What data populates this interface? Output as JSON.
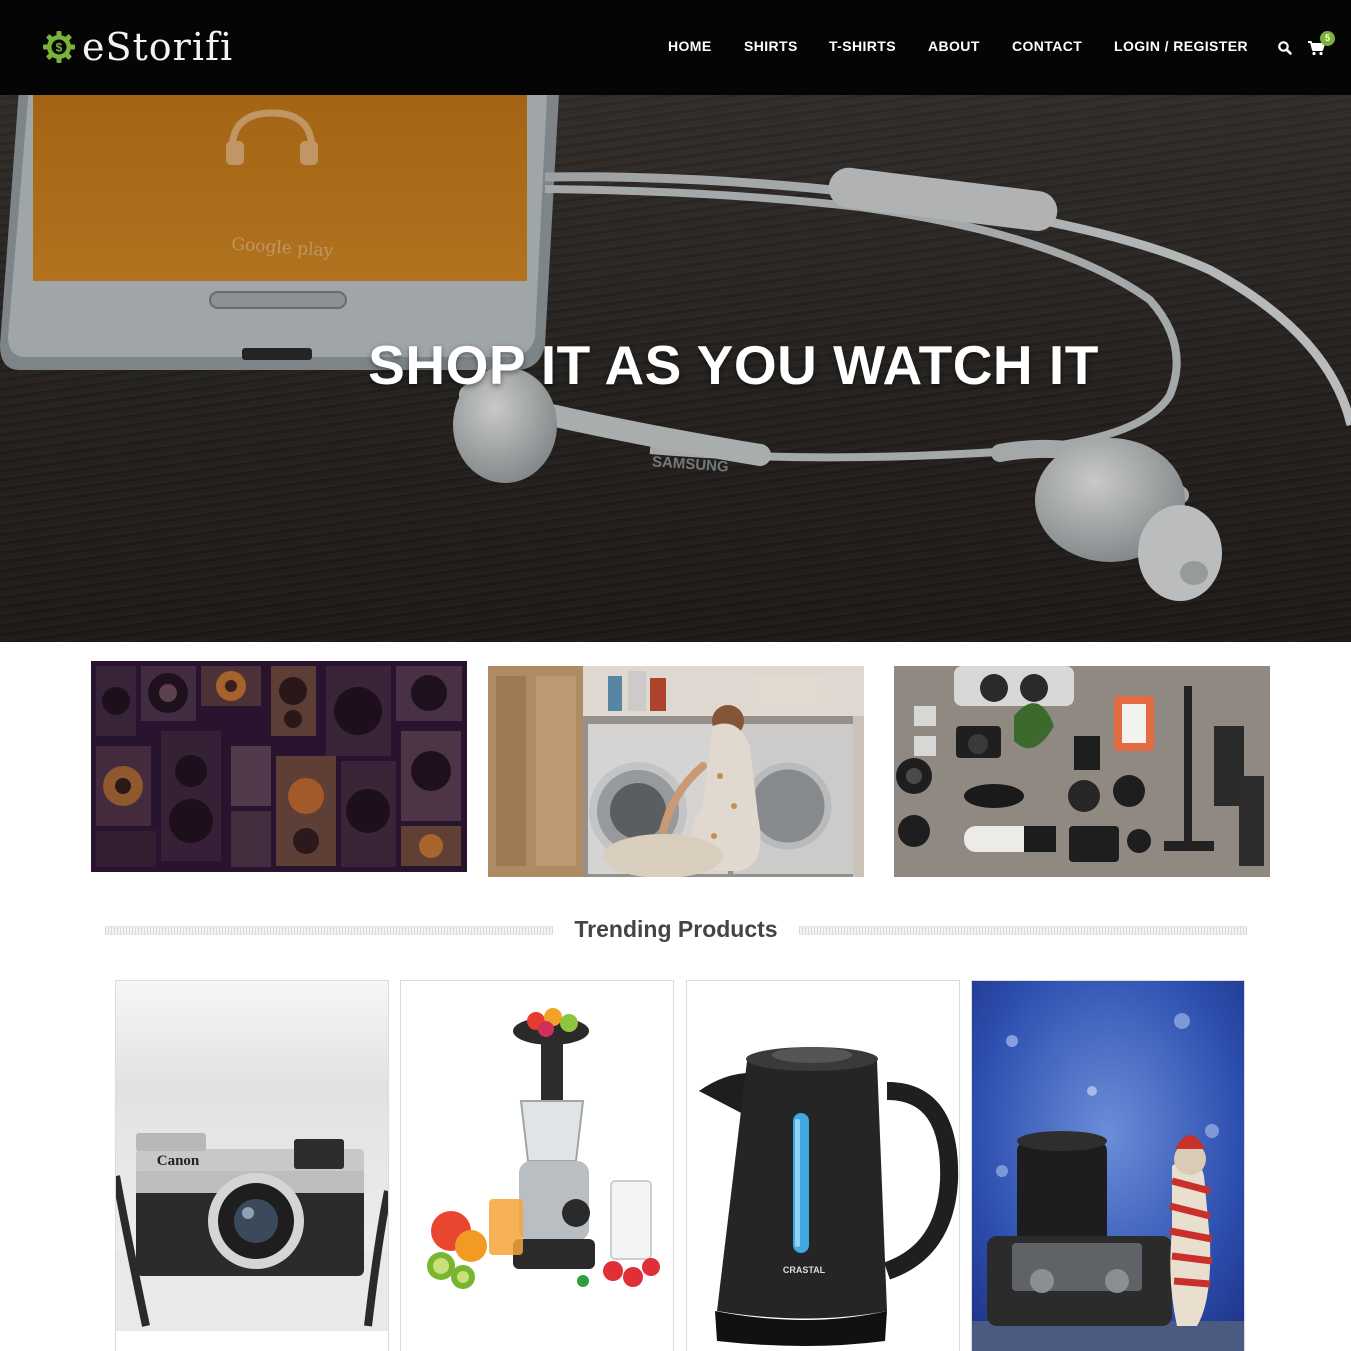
{
  "brand": {
    "name": "eStorifi",
    "logo_icon": "dollar-gear-icon",
    "accent_color": "#7bb33a"
  },
  "nav": {
    "items": [
      {
        "label": "HOME"
      },
      {
        "label": "SHIRTS"
      },
      {
        "label": "T-SHIRTS"
      },
      {
        "label": "ABOUT"
      },
      {
        "label": "CONTACT"
      },
      {
        "label": "LOGIN / REGISTER"
      }
    ],
    "search_icon": "search-icon",
    "cart_icon": "shopping-cart-icon",
    "cart_count": "5"
  },
  "hero": {
    "title": "SHOP IT AS YOU WATCH IT",
    "phone_screen_text": "Google play",
    "earbud_brand": "SAMSUNG"
  },
  "categories": [
    {
      "image": "vintage speakers wall"
    },
    {
      "image": "woman loading washing machine"
    },
    {
      "image": "camera gear flat lay"
    }
  ],
  "trending": {
    "title": "Trending Products",
    "products": [
      {
        "image": "canon rangefinder camera",
        "brand_mark": "Canon"
      },
      {
        "image": "slow juicer with fruit"
      },
      {
        "image": "black electric kettle",
        "brand_mark": "CRASTAL"
      },
      {
        "image": "mirrorless camera with toy figure"
      }
    ]
  }
}
